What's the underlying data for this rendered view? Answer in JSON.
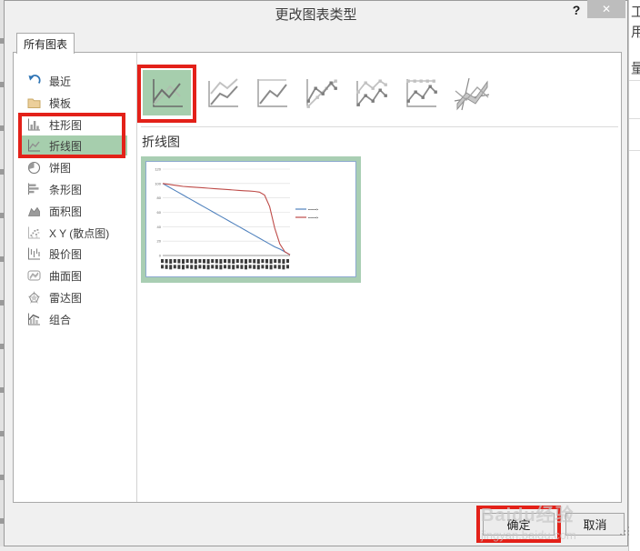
{
  "window": {
    "title": "更改图表类型",
    "help_label": "?",
    "close_label": "✕"
  },
  "tab": {
    "label": "所有图表"
  },
  "sidebar": {
    "items": [
      {
        "label": "最近",
        "icon": "recent-icon"
      },
      {
        "label": "模板",
        "icon": "template-folder-icon"
      },
      {
        "label": "柱形图",
        "icon": "column-chart-icon"
      },
      {
        "label": "折线图",
        "icon": "line-chart-icon",
        "selected": true
      },
      {
        "label": "饼图",
        "icon": "pie-chart-icon"
      },
      {
        "label": "条形图",
        "icon": "bar-chart-icon"
      },
      {
        "label": "面积图",
        "icon": "area-chart-icon"
      },
      {
        "label": "X Y (散点图)",
        "icon": "scatter-chart-icon"
      },
      {
        "label": "股价图",
        "icon": "stock-chart-icon"
      },
      {
        "label": "曲面图",
        "icon": "surface-chart-icon"
      },
      {
        "label": "雷达图",
        "icon": "radar-chart-icon"
      },
      {
        "label": "组合",
        "icon": "combo-chart-icon"
      }
    ]
  },
  "subtypes": {
    "heading": "折线图",
    "selected_index": 0,
    "icons": [
      "line",
      "stacked-line",
      "100-percent-stacked-line",
      "line-with-markers",
      "stacked-line-with-markers",
      "100-percent-stacked-line-with-markers",
      "3d-line"
    ]
  },
  "preview": {
    "legend": [
      {
        "label": "▪▪▪▪▪▪▪▪/▪",
        "color": "#4f81bd"
      },
      {
        "label": "▪▪▪▪▪▪▪▪/▪",
        "color": "#be4b48"
      }
    ]
  },
  "chart_data": {
    "type": "line",
    "title": "",
    "xlabel": "",
    "ylabel": "",
    "ylim": [
      0,
      120
    ],
    "yticks": [
      0,
      20,
      40,
      60,
      80,
      100,
      120
    ],
    "x_tick_labels": "dense-illegible-rotated",
    "grid": true,
    "legend_position": "right",
    "series": [
      {
        "name": "series-blue",
        "color": "#4f81bd",
        "values": [
          100,
          96,
          92,
          88,
          84,
          80,
          76,
          72,
          68,
          64,
          60,
          56,
          52,
          48,
          44,
          40,
          36,
          32,
          28,
          24,
          20,
          16,
          12,
          9,
          5,
          1
        ]
      },
      {
        "name": "series-red",
        "color": "#be4b48",
        "values": [
          100,
          99,
          98,
          97,
          96,
          95.5,
          95,
          94.5,
          94,
          93.5,
          93,
          92.5,
          92,
          91.5,
          91,
          90.5,
          90,
          89.5,
          89,
          88,
          84,
          68,
          38,
          16,
          5,
          1
        ]
      }
    ]
  },
  "footer": {
    "ok_label": "确定",
    "cancel_label": "取消"
  },
  "watermark": {
    "line1": "Baidu经验",
    "line2": "jingyan.baidu.com"
  },
  "background": {
    "fragments": [
      "工",
      "用",
      "量"
    ]
  },
  "colors": {
    "selection_green": "#a6cead",
    "annotation_red": "#e32119",
    "series_blue": "#4f81bd",
    "series_red": "#be4b48"
  }
}
